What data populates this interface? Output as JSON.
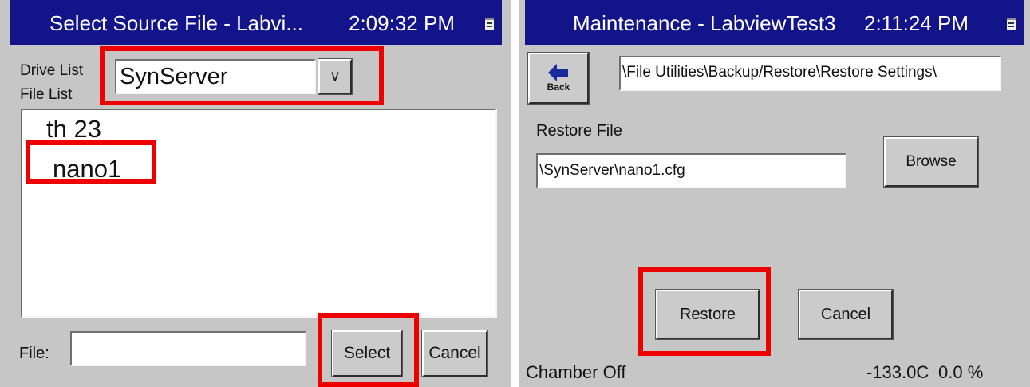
{
  "left_window": {
    "title": "Select Source File - Labvi...",
    "time": "2:09:32 PM",
    "drive_list_label": "Drive List",
    "file_list_label": "File List",
    "drive_value": "SynServer",
    "drive_dropdown_glyph": "v",
    "files": [
      "th 23",
      "nano1"
    ],
    "file_label": "File:",
    "file_value": "",
    "select_label": "Select",
    "cancel_label": "Cancel"
  },
  "right_window": {
    "title": "Maintenance - LabviewTest3",
    "time": "2:11:24 PM",
    "back_label": "Back",
    "path_value": "\\File Utilities\\Backup/Restore\\Restore Settings\\",
    "restore_file_label": "Restore File",
    "restore_file_value": "\\SynServer\\nano1.cfg",
    "browse_label": "Browse",
    "restore_label": "Restore",
    "cancel_label": "Cancel",
    "status_text": "Chamber Off",
    "temperature": "-133.0C",
    "humidity": "0.0 %"
  },
  "colors": {
    "titlebar": "#14148a",
    "window_background": "#c6c6c6",
    "highlight_border": "#ee0000",
    "back_arrow": "#1a2a9a"
  },
  "icons": {
    "titlebar_icon": "sip-keyboard-icon",
    "back_icon": "left-arrow-icon"
  }
}
